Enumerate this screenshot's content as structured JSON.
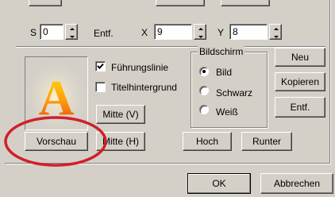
{
  "top_row": {
    "s_label": "S",
    "s_value": "0",
    "entf_label": "Entf.",
    "x_label": "X",
    "x_value": "9",
    "y_label": "Y",
    "y_value": "8"
  },
  "preview": {
    "letter": "A"
  },
  "checkboxes": {
    "fuehrungslinie": {
      "label": "Führungslinie",
      "checked": true
    },
    "titelhintergrund": {
      "label": "Titelhintergrund",
      "checked": false
    }
  },
  "bildschirm": {
    "legend": "Bildschirm",
    "options": [
      "Bild",
      "Schwarz",
      "Weiß"
    ],
    "selected": "Bild"
  },
  "buttons": {
    "neu": "Neu",
    "kopieren": "Kopieren",
    "entf": "Entf.",
    "mitte_v": "Mitte (V)",
    "mitte_h": "Mitte (H)",
    "vorschau": "Vorschau",
    "hoch": "Hoch",
    "runter": "Runter",
    "ok": "OK",
    "abbrechen": "Abbrechen"
  },
  "colors": {
    "highlight_ellipse": "#d0202a",
    "letter_top": "#ffd400",
    "letter_bottom": "#e8500a"
  }
}
